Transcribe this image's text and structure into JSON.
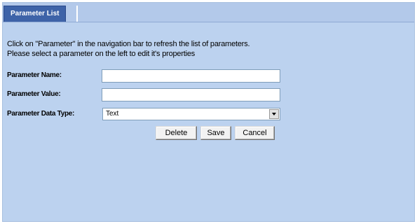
{
  "tab": {
    "label": "Parameter List"
  },
  "instructions": {
    "line1": "Click on \"Parameter\" in the navigation bar to refresh the list of parameters.",
    "line2": "Please select a parameter on the left to edit it's properties"
  },
  "form": {
    "name_label": "Parameter Name:",
    "name_value": "",
    "value_label": "Parameter Value:",
    "value_value": "",
    "type_label": "Parameter Data Type:",
    "type_selected": "Text"
  },
  "buttons": {
    "delete": "Delete",
    "save": "Save",
    "cancel": "Cancel"
  },
  "colors": {
    "panel_bg": "#bcd2ef",
    "tab_bg": "#3e63a8"
  },
  "icons": {
    "dropdown": "chevron-down-icon"
  }
}
